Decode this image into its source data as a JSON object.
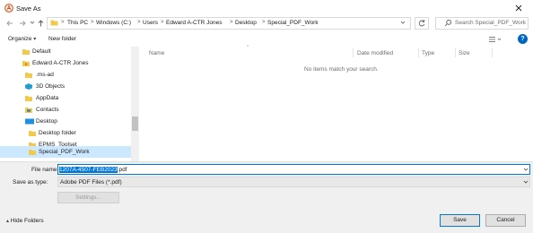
{
  "window": {
    "title": "Save As"
  },
  "address": {
    "crumbs": [
      "This PC",
      "Windows (C:)",
      "Users",
      "Edward A-CTR Jones",
      "Desktop",
      "Special_PDF_Work"
    ],
    "separator": ">"
  },
  "search": {
    "placeholder": "Search Special_PDF_Work"
  },
  "toolbar": {
    "organize_label": "Organize",
    "new_folder_label": "New folder",
    "help_label": "?"
  },
  "nav": {
    "items": [
      {
        "label": "Default",
        "icon": "folder-icon"
      },
      {
        "label": "Edward A-CTR Jones",
        "icon": "user-icon"
      },
      {
        "label": ".ms-ad",
        "icon": "folder-icon"
      },
      {
        "label": "3D Objects",
        "icon": "3d-objects-icon"
      },
      {
        "label": "AppData",
        "icon": "folder-icon"
      },
      {
        "label": "Contacts",
        "icon": "contacts-icon"
      },
      {
        "label": "Desktop",
        "icon": "desktop-icon"
      },
      {
        "label": "Desktop folder",
        "icon": "folder-icon"
      },
      {
        "label": "EPMS_Toolset",
        "icon": "folder-icon"
      },
      {
        "label": "Special_PDF_Work",
        "icon": "folder-icon",
        "selected": true
      }
    ]
  },
  "content": {
    "columns": [
      "Name",
      "Date modified",
      "Type",
      "Size"
    ],
    "empty_message": "No items match your search."
  },
  "form": {
    "file_name_label": "File name:",
    "file_name_selected": "1207A-4507-FEB2023",
    "file_name_rest": ".pdf",
    "save_as_type_label": "Save as type:",
    "save_as_type_value": "Adobe PDF Files (*.pdf)",
    "settings_label": "Settings..."
  },
  "footer": {
    "hide_folders_label": "Hide Folders",
    "save_label": "Save",
    "cancel_label": "Cancel"
  },
  "colors": {
    "accent": "#0078d7",
    "selection": "#cce8ff",
    "panel": "#f0f0f0",
    "app_icon": "#d83b01"
  }
}
